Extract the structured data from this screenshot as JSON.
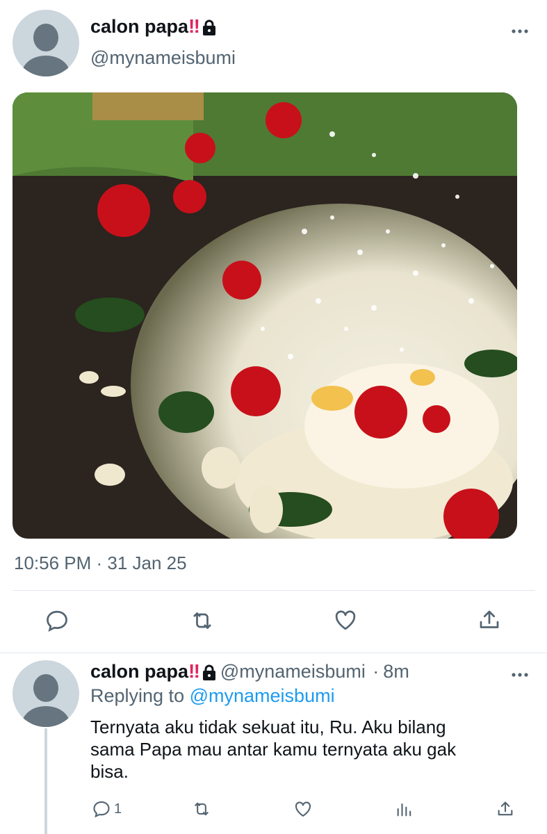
{
  "tweet": {
    "display_name": "calon papa",
    "emoji": "‼",
    "handle": "@mynameisbumi",
    "timestamp": "10:56 PM · 31 Jan 25",
    "more_icon": "more-horizontal-icon",
    "media_description_icon": "photo-roses-on-grave",
    "actions": {
      "reply_icon": "reply-icon",
      "retweet_icon": "retweet-icon",
      "like_icon": "like-icon",
      "share_icon": "share-icon"
    }
  },
  "reply": {
    "display_name": "calon papa",
    "emoji": "‼",
    "handle": "@mynameisbumi",
    "separator": "·",
    "age": "8m",
    "replying_label": "Replying to",
    "replying_to": "@mynameisbumi",
    "text_line1": "Ternyata aku tidak sekuat itu, Ru. Aku bilang",
    "text_line2": "sama Papa mau antar kamu ternyata aku gak",
    "text_line3": "bisa.",
    "reply_count": "1",
    "colors": {
      "link": "#1d9bf0",
      "secondary": "#536471",
      "emoji": "#e0245e"
    }
  }
}
